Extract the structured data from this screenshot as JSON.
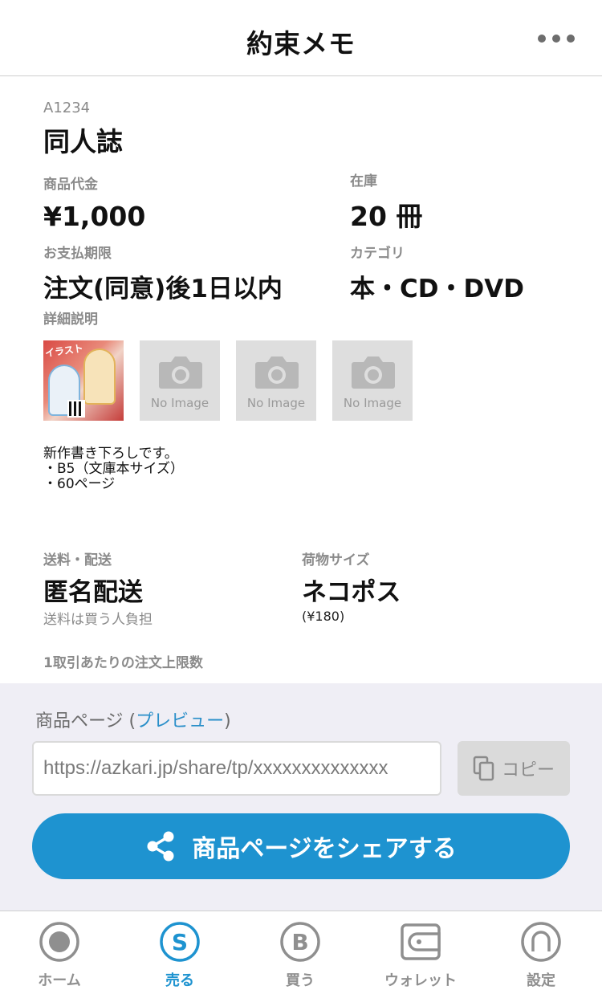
{
  "header": {
    "title": "約束メモ",
    "more_icon": "more-horizontal-icon"
  },
  "item": {
    "code": "A1234",
    "name": "同人誌",
    "price_label": "商品代金",
    "price": "¥1,000",
    "stock_label": "在庫",
    "stock": "20 冊",
    "deadline_label": "お支払期限",
    "deadline": "注文(同意)後1日以内",
    "category_label": "カテゴリ",
    "category": "本・CD・DVD",
    "details_label": "詳細説明",
    "images": [
      {
        "type": "photo",
        "text": "イラスト"
      },
      {
        "type": "placeholder",
        "caption": "No Image"
      },
      {
        "type": "placeholder",
        "caption": "No Image"
      },
      {
        "type": "placeholder",
        "caption": "No Image"
      }
    ],
    "description": "新作書き下ろしです。\n・B5（文庫本サイズ）\n・60ページ",
    "shipping_label": "送料・配送",
    "shipping": "匿名配送",
    "shipping_note": "送料は買う人負担",
    "package_label": "荷物サイズ",
    "package": "ネコポス",
    "package_price": "(¥180)",
    "order_limit_label": "1取引あたりの注文上限数"
  },
  "share": {
    "label_prefix": "商品ページ (",
    "preview_link": "プレビュー",
    "label_suffix": ")",
    "url": "https://azkari.jp/share/tp/xxxxxxxxxxxxxx",
    "copy_label": "コピー",
    "share_button_label": "商品ページをシェアする",
    "accent_color": "#1e93d0"
  },
  "tabs": [
    {
      "label": "ホーム",
      "icon": "home-icon",
      "active": false
    },
    {
      "label": "売る",
      "icon": "sell-icon",
      "active": true
    },
    {
      "label": "買う",
      "icon": "buy-icon",
      "active": false
    },
    {
      "label": "ウォレット",
      "icon": "wallet-icon",
      "active": false
    },
    {
      "label": "設定",
      "icon": "settings-icon",
      "active": false
    }
  ]
}
